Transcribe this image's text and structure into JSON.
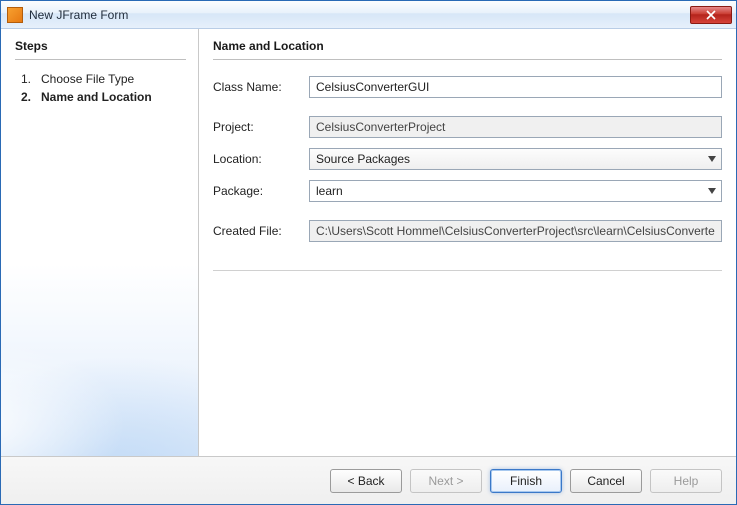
{
  "window": {
    "title": "New JFrame Form"
  },
  "sidebar": {
    "header": "Steps",
    "steps": [
      {
        "num": "1.",
        "label": "Choose File Type"
      },
      {
        "num": "2.",
        "label": "Name and Location"
      }
    ],
    "currentStepIndex": 1
  },
  "content": {
    "header": "Name and Location",
    "fields": {
      "class_name_label": "Class Name:",
      "class_name_value": "CelsiusConverterGUI",
      "project_label": "Project:",
      "project_value": "CelsiusConverterProject",
      "location_label": "Location:",
      "location_value": "Source Packages",
      "package_label": "Package:",
      "package_value": "learn",
      "created_file_label": "Created File:",
      "created_file_value": "C:\\Users\\Scott Hommel\\CelsiusConverterProject\\src\\learn\\CelsiusConverterGUI.java"
    }
  },
  "buttons": {
    "back": "< Back",
    "next": "Next >",
    "finish": "Finish",
    "cancel": "Cancel",
    "help": "Help"
  }
}
